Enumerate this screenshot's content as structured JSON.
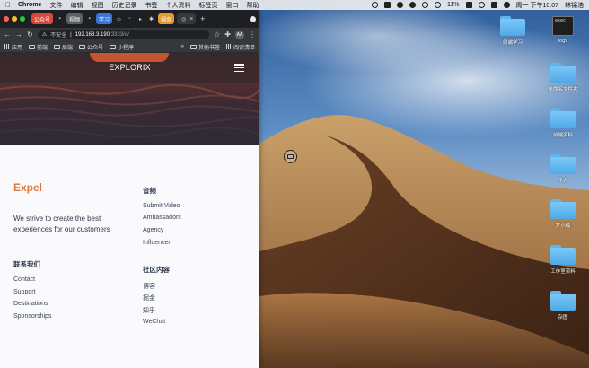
{
  "menubar": {
    "app": "Chrome",
    "items": [
      "文件",
      "编辑",
      "视图",
      "历史记录",
      "书签",
      "个人资料",
      "标签页",
      "窗口",
      "帮助"
    ],
    "battery": "11%",
    "clock": "周一 下午10:07",
    "user": "林锦浩"
  },
  "browser": {
    "tabs": {
      "tab1": "公众号",
      "tab2": "视频",
      "tab3": "学习",
      "tab4": "掘金",
      "new_tab": "+",
      "close": "×"
    },
    "address": {
      "security": "不安全",
      "host": "192.168.3.190",
      "path": ":3333/#/"
    },
    "profile_initials": "AA",
    "bookmarks": {
      "apps": "应用",
      "b1": "前端",
      "b2": "后端",
      "b3": "公众号",
      "b4": "小程序",
      "more": "»",
      "other": "其他书签",
      "reading": "阅读清单"
    }
  },
  "site": {
    "brand": "EXPLORIX",
    "title": "Expel",
    "tagline": "We strive to create the best experiences for our customers",
    "contact_heading": "联系我们",
    "contact_links": [
      "Contact",
      "Support",
      "Destinations",
      "Sponsorships"
    ],
    "music_heading": "音频",
    "music_links": [
      "Submit Video",
      "Ambassadors",
      "Agency",
      "Influencer"
    ],
    "community_heading": "社区内容",
    "community_links": [
      "博客",
      "掘金",
      "知乎",
      "WeChat"
    ]
  },
  "desktop": {
    "icons": [
      {
        "label": "前端学习",
        "icon": "folder-icon"
      },
      {
        "label": "logs",
        "icon": "terminal-icon"
      },
      {
        "label": "未命名文件夹",
        "icon": "folder-icon"
      },
      {
        "label": "前端资料",
        "icon": "folder-icon"
      },
      {
        "label": "个人",
        "icon": "folder-icon"
      },
      {
        "label": "罗小楠",
        "icon": "folder-icon"
      },
      {
        "label": "工作室资料",
        "icon": "folder-icon"
      },
      {
        "label": "杂图",
        "icon": "folder-icon"
      }
    ]
  },
  "colors": {
    "brand_orange": "#e07a3b",
    "chrome_dark": "#35373b",
    "folder_blue": "#5eb6f0"
  }
}
